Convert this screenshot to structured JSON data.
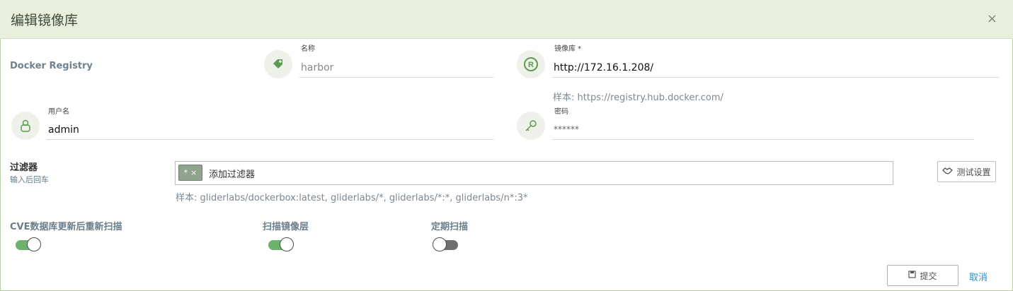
{
  "dialog": {
    "title": "编辑镜像库",
    "close_icon": "×"
  },
  "registry": {
    "type": "Docker Registry",
    "name_label": "名称",
    "name_value": "harbor",
    "url_label": "镜像库 *",
    "url_value": "http://172.16.1.208/",
    "url_hint": "样本: https://registry.hub.docker.com/",
    "username_label": "用户名",
    "username_value": "admin",
    "password_label": "密码",
    "password_value": "******"
  },
  "filter": {
    "title": "过滤器",
    "subtitle": "输入后回车",
    "chip_text": "*",
    "chip_remove": "×",
    "placeholder": "添加过滤器",
    "example": "样本: gliderlabs/dockerbox:latest, gliderlabs/*, gliderlabs/*:*, gliderlabs/n*:3*",
    "test_button": "测试设置"
  },
  "toggles": {
    "cve_rescan": {
      "label": "CVE数据库更新后重新扫描",
      "on": true
    },
    "scan_layers": {
      "label": "扫描镜像层",
      "on": true
    },
    "periodic_scan": {
      "label": "定期扫描",
      "on": false
    }
  },
  "footer": {
    "submit": "提交",
    "cancel": "取消"
  },
  "colors": {
    "header_bg": "#e8efdd",
    "toggle_on": "#6cb26d",
    "toggle_off": "#6f6f6f",
    "link": "#2a8fd3",
    "icon": "#5d9a4f"
  },
  "icons": {
    "name": "tag-icon",
    "registry": "registered-icon",
    "username": "user-icon",
    "password": "key-icon",
    "test": "handshake-icon",
    "submit": "save-icon"
  }
}
